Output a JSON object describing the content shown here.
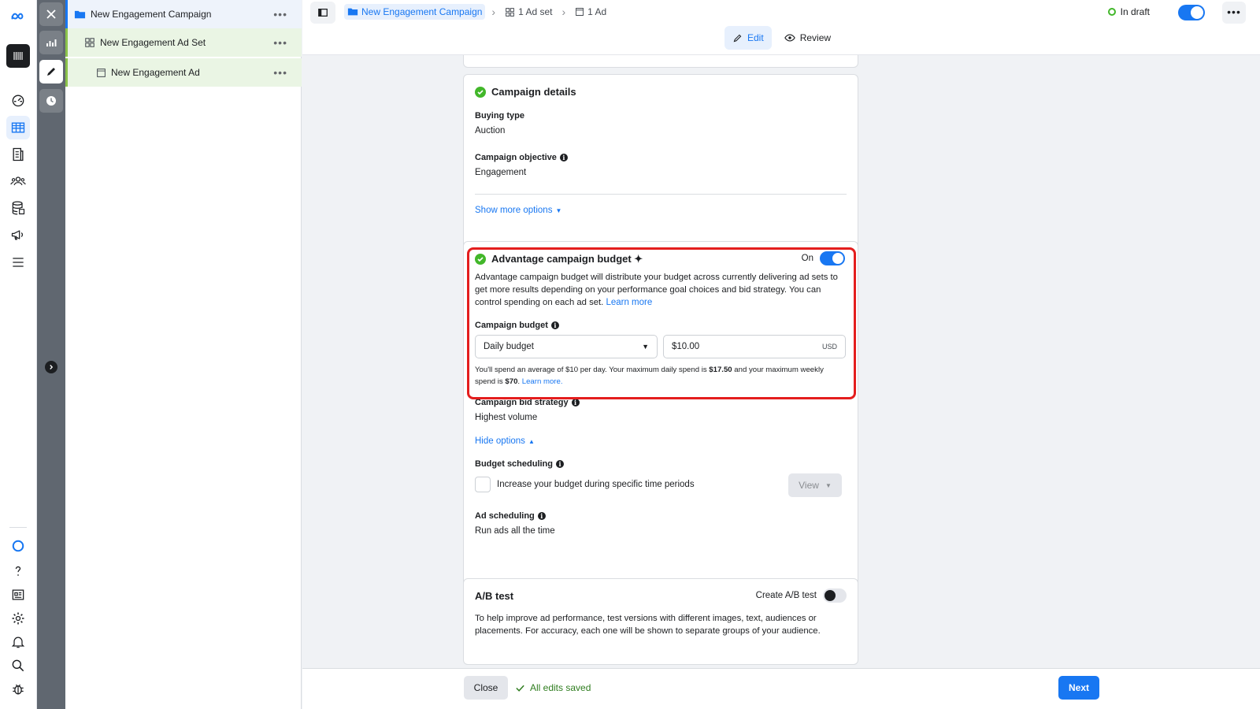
{
  "tree": {
    "campaign": "New Engagement Campaign",
    "adset": "New Engagement Ad Set",
    "ad": "New Engagement Ad",
    "more": "•••"
  },
  "topbar": {
    "crumbs": {
      "campaign": "New Engagement Campaign",
      "adset": "1 Ad set",
      "ad": "1 Ad"
    },
    "status": "In draft",
    "more": "•••",
    "tabs": {
      "edit": "Edit",
      "review": "Review"
    }
  },
  "campaign_details": {
    "title": "Campaign details",
    "buying_type_label": "Buying type",
    "buying_type_value": "Auction",
    "objective_label": "Campaign objective",
    "objective_value": "Engagement",
    "show_more": "Show more options"
  },
  "advantage": {
    "title": "Advantage campaign budget ✦",
    "on_label": "On",
    "description": "Advantage campaign budget will distribute your budget across currently delivering ad sets to get more results depending on your performance goal choices and bid strategy. You can control spending on each ad set.",
    "learn_more": "Learn more",
    "budget_label": "Campaign budget",
    "budget_type": "Daily budget",
    "budget_amount": "$10.00",
    "currency": "USD",
    "spend_note_1": "You'll spend an average of $10 per day. Your maximum daily spend is ",
    "spend_max_daily": "$17.50",
    "spend_note_2": " and your maximum weekly spend is ",
    "spend_max_weekly": "$70",
    "spend_note_3": ".",
    "spend_learn_more": "Learn more."
  },
  "bid": {
    "strategy_label": "Campaign bid strategy",
    "strategy_value": "Highest volume",
    "hide_options": "Hide options",
    "scheduling_label": "Budget scheduling",
    "scheduling_checkbox": "Increase your budget during specific time periods",
    "view_button": "View",
    "ad_scheduling_label": "Ad scheduling",
    "ad_scheduling_value": "Run ads all the time"
  },
  "ab_test": {
    "title": "A/B test",
    "create_label": "Create A/B test",
    "description": "To help improve ad performance, test versions with different images, text, audiences or placements. For accuracy, each one will be shown to separate groups of your audience."
  },
  "footer": {
    "close": "Close",
    "saved": "All edits saved",
    "next": "Next"
  },
  "colors": {
    "brand_blue": "#1877f2",
    "success_green": "#42b72a",
    "highlight_red": "#e41e1e"
  },
  "icons": [
    "meta-logo-icon",
    "grid-icon",
    "dashboard-icon",
    "table-icon",
    "report-icon",
    "audience-icon",
    "database-icon",
    "megaphone-icon",
    "menu-icon",
    "meta-ai-icon",
    "help-icon",
    "news-icon",
    "gear-icon",
    "bell-icon",
    "search-icon",
    "bug-icon",
    "close-icon",
    "bar-chart-icon",
    "pencil-icon",
    "clock-icon",
    "chevron-right-icon",
    "folder-icon",
    "panel-icon",
    "eye-icon",
    "check-icon",
    "info-icon",
    "caret-down-icon"
  ]
}
